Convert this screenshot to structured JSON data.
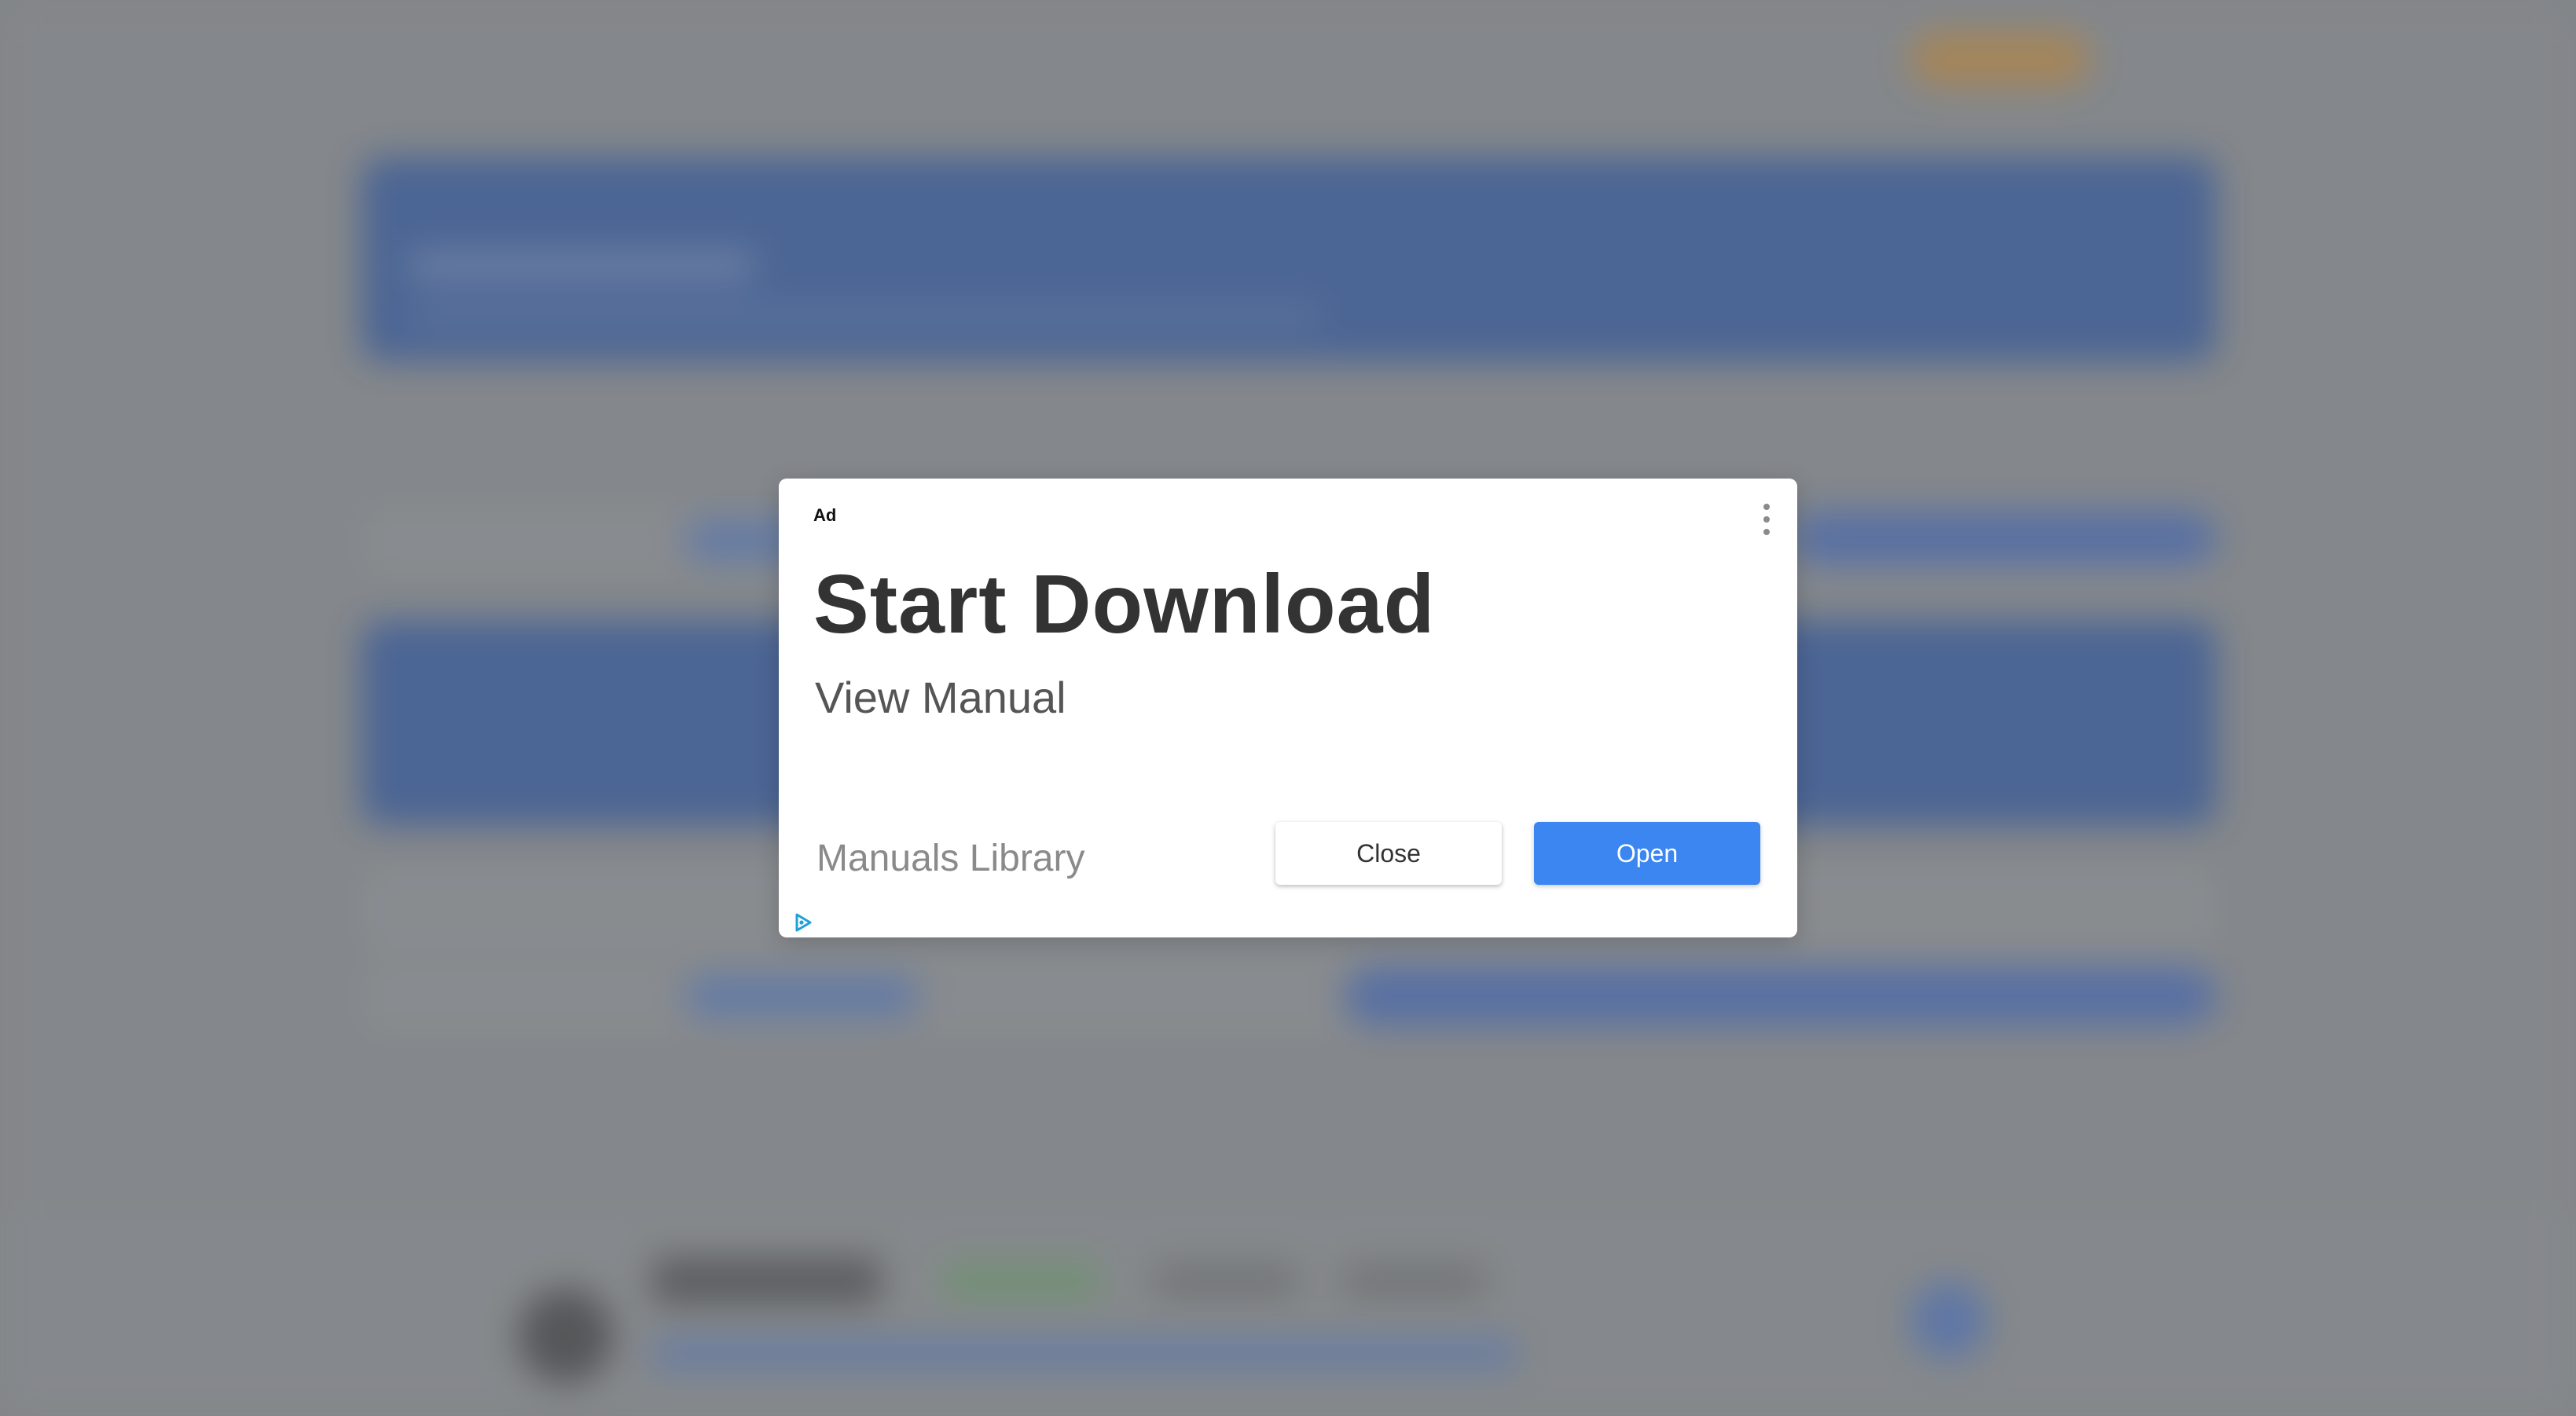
{
  "ad": {
    "badge": "Ad",
    "headline": "Start Download",
    "subheadline": "View Manual",
    "advertiser": "Manuals Library",
    "close_label": "Close",
    "open_label": "Open",
    "menu_icon": "kebab-menu-icon",
    "adchoices_icon": "adchoices-icon"
  },
  "colors": {
    "open_button": "#3b86f1",
    "headline": "#333333",
    "overlay": "#86898c"
  }
}
